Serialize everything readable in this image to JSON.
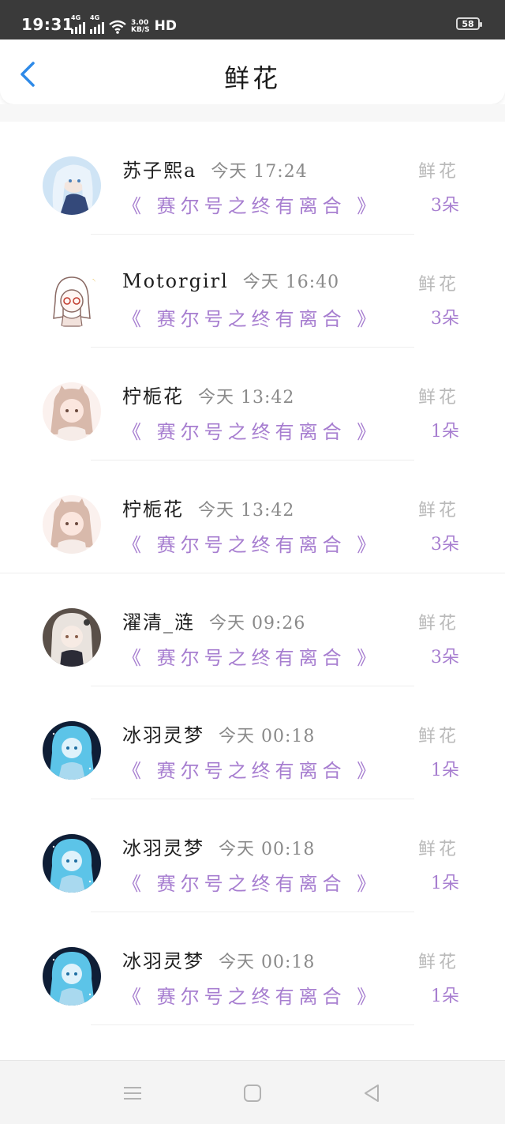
{
  "status_bar": {
    "time": "19:31",
    "network_tag_1": "4G",
    "network_tag_2": "4G",
    "speed_value": "3.00",
    "speed_unit": "KB/S",
    "hd_label": "HD",
    "battery": "58"
  },
  "header": {
    "title": "鲜花",
    "back_icon": "chevron-left-icon",
    "accent_color": "#2f8ae8"
  },
  "colors": {
    "book_title": "#a77ed0",
    "gift_label": "#b9b9b9",
    "username": "#1e1e1e",
    "timestamp": "#8a8a8a"
  },
  "records": [
    {
      "username": "苏子熙a",
      "time": "今天 17:24",
      "book": "《 赛尔号之终有离合 》",
      "gift_type": "鲜花",
      "count": "3朵"
    },
    {
      "username": "Motorgirl",
      "time": "今天 16:40",
      "book": "《 赛尔号之终有离合 》",
      "gift_type": "鲜花",
      "count": "3朵"
    },
    {
      "username": "柠栀花",
      "time": "今天 13:42",
      "book": "《 赛尔号之终有离合 》",
      "gift_type": "鲜花",
      "count": "1朵"
    },
    {
      "username": "柠栀花",
      "time": "今天 13:42",
      "book": "《 赛尔号之终有离合 》",
      "gift_type": "鲜花",
      "count": "3朵"
    },
    {
      "username": "濯清_涟",
      "time": "今天 09:26",
      "book": "《 赛尔号之终有离合 》",
      "gift_type": "鲜花",
      "count": "3朵"
    },
    {
      "username": "冰羽灵梦",
      "time": "今天 00:18",
      "book": "《 赛尔号之终有离合 》",
      "gift_type": "鲜花",
      "count": "1朵"
    },
    {
      "username": "冰羽灵梦",
      "time": "今天 00:18",
      "book": "《 赛尔号之终有离合 》",
      "gift_type": "鲜花",
      "count": "1朵"
    },
    {
      "username": "冰羽灵梦",
      "time": "今天 00:18",
      "book": "《 赛尔号之终有离合 》",
      "gift_type": "鲜花",
      "count": "1朵"
    }
  ],
  "nav_bar": {
    "menu_icon": "menu-icon",
    "home_icon": "home-square-icon",
    "back_icon": "back-triangle-icon"
  }
}
